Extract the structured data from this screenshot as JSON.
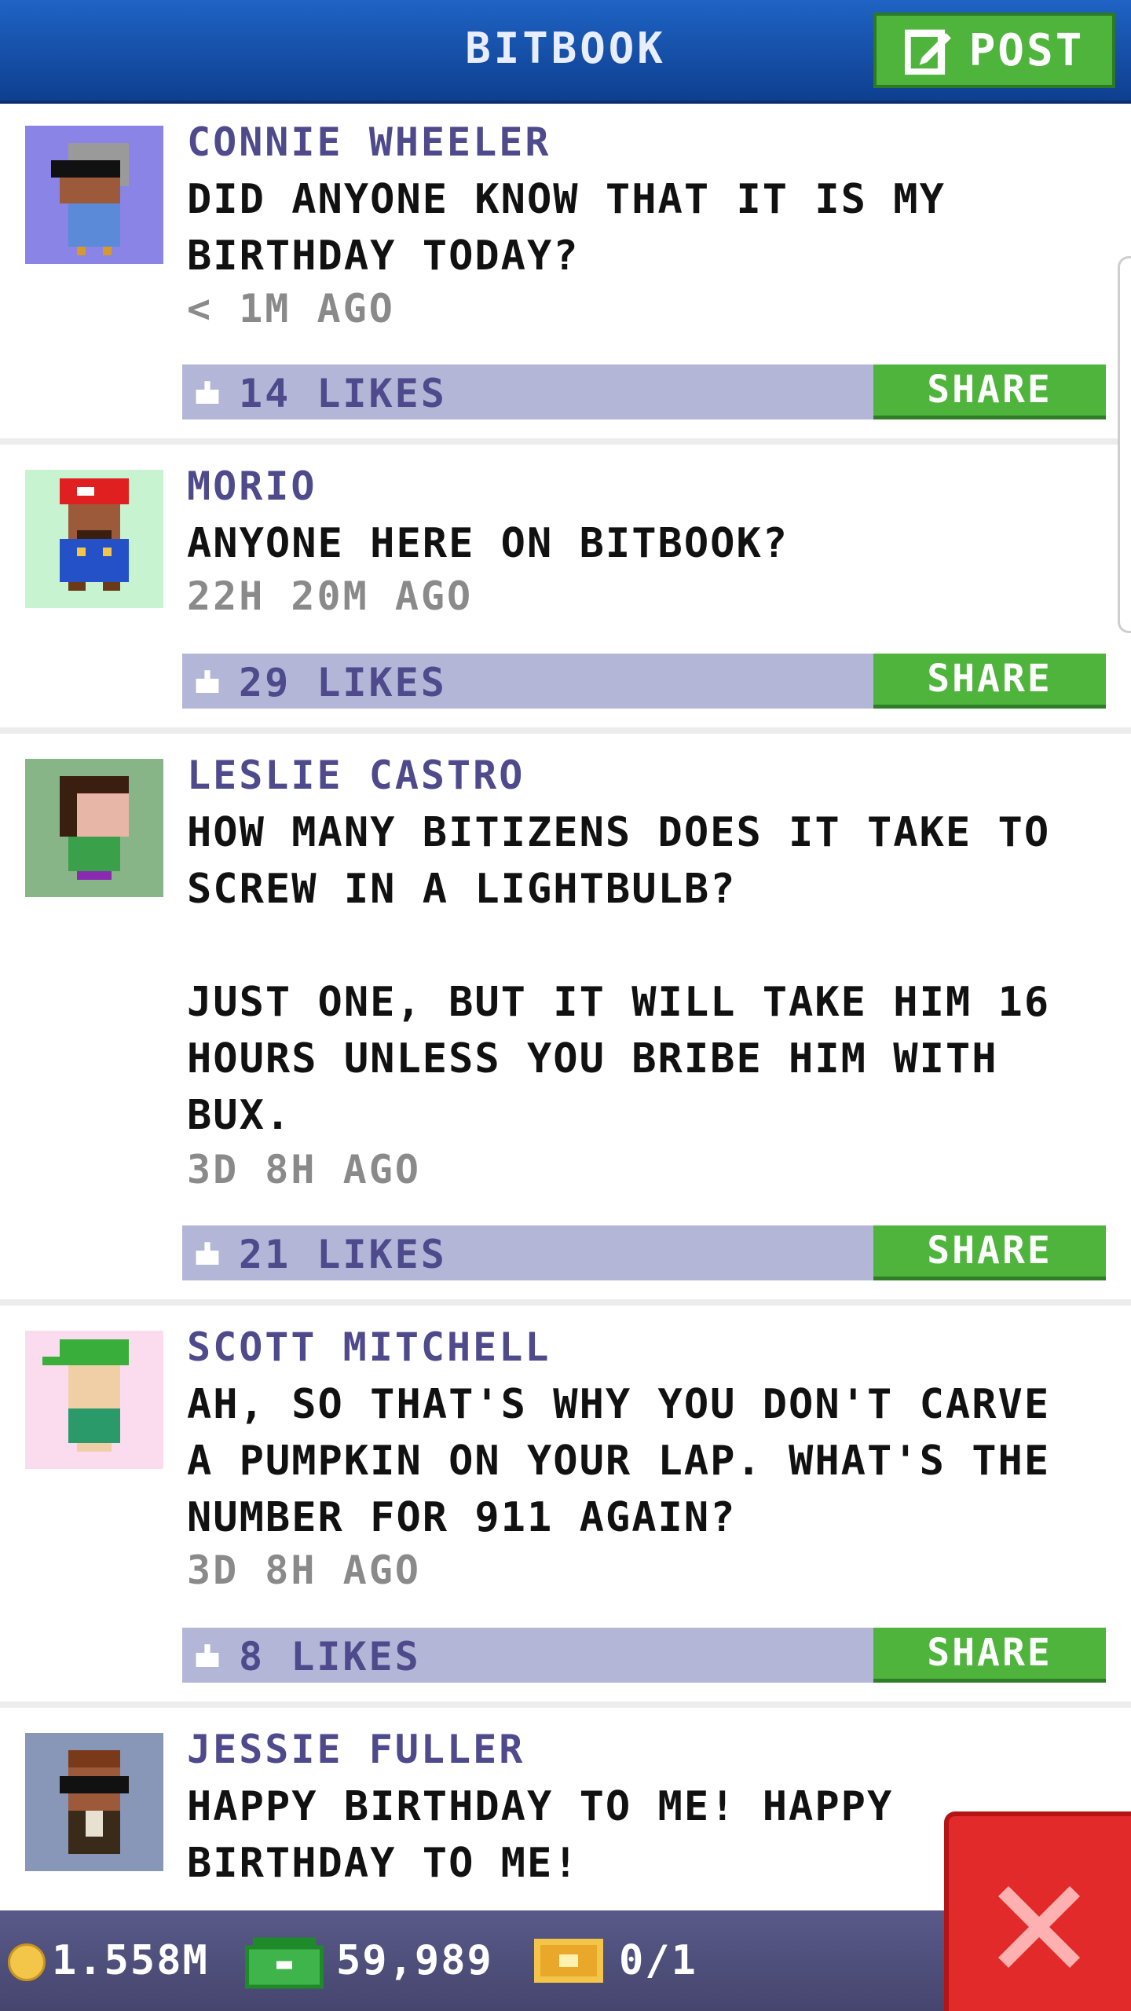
{
  "header": {
    "title": "BITBOOK",
    "post_label": "POST"
  },
  "posts": [
    {
      "author": "CONNIE WHEELER",
      "message": "DID ANYONE KNOW THAT IT IS MY\nBIRTHDAY TODAY?",
      "time": "< 1M AGO",
      "likes": "14 LIKES",
      "share": "SHARE",
      "avatar_bg": "#8a84e6"
    },
    {
      "author": "MORIO",
      "message": "ANYONE HERE ON BITBOOK?",
      "time": "22H 20M AGO",
      "likes": "29 LIKES",
      "share": "SHARE",
      "avatar_bg": "#c8f3d0"
    },
    {
      "author": "LESLIE CASTRO",
      "message": "HOW MANY BITIZENS DOES IT TAKE TO\nSCREW IN A LIGHTBULB?\n\nJUST ONE, BUT IT WILL TAKE HIM 16\nHOURS UNLESS YOU BRIBE HIM WITH\nBUX.",
      "time": "3D 8H AGO",
      "likes": "21 LIKES",
      "share": "SHARE",
      "avatar_bg": "#88b588"
    },
    {
      "author": "SCOTT MITCHELL",
      "message": "AH, SO THAT'S WHY YOU DON'T CARVE\nA PUMPKIN ON YOUR LAP. WHAT'S THE\nNUMBER FOR 911 AGAIN?",
      "time": "3D 8H AGO",
      "likes": "8 LIKES",
      "share": "SHARE",
      "avatar_bg": "#fbdcef"
    },
    {
      "author": "JESSIE FULLER",
      "message": "HAPPY BIRTHDAY TO ME! HAPPY\nBIRTHDAY TO ME!",
      "avatar_bg": "#8896b8"
    }
  ],
  "bottom": {
    "coins": "1.558M",
    "bux": "59,989",
    "tickets": "0/1"
  },
  "icons": {
    "coin": "coin-icon",
    "bux": "bux-icon",
    "ticket": "ticket-icon",
    "like": "thumbs-up-icon",
    "post": "edit-icon",
    "close": "close-icon"
  }
}
